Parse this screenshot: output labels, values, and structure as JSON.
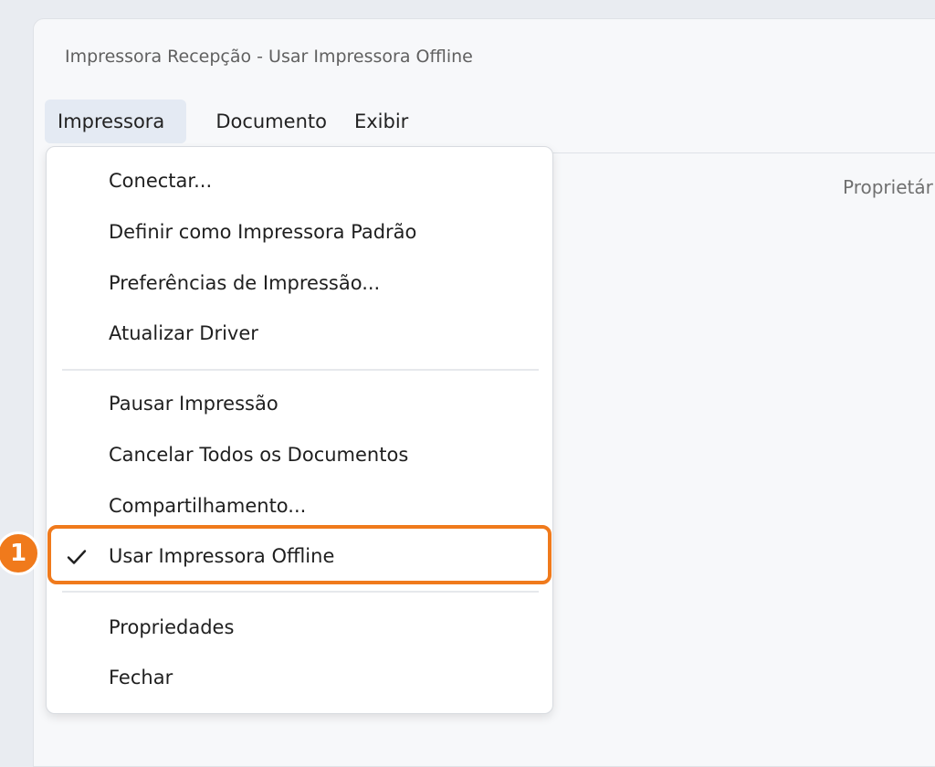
{
  "window": {
    "title": "Impressora Recepção - Usar Impressora Offline"
  },
  "menubar": {
    "printer": "Impressora",
    "document": "Documento",
    "view": "Exibir"
  },
  "content": {
    "owner_header": "Proprietár"
  },
  "menu": {
    "items": [
      {
        "label": "Conectar..."
      },
      {
        "label": "Definir como Impressora Padrão"
      },
      {
        "label": "Preferências de Impressão..."
      },
      {
        "label": "Atualizar Driver"
      },
      {
        "label": "Pausar Impressão"
      },
      {
        "label": "Cancelar Todos os Documentos"
      },
      {
        "label": "Compartilhamento..."
      },
      {
        "label": "Usar Impressora Offline",
        "checked": true
      },
      {
        "label": "Propriedades"
      },
      {
        "label": "Fechar"
      }
    ]
  },
  "annotation": {
    "step": "1",
    "color": "#f07a1c"
  }
}
